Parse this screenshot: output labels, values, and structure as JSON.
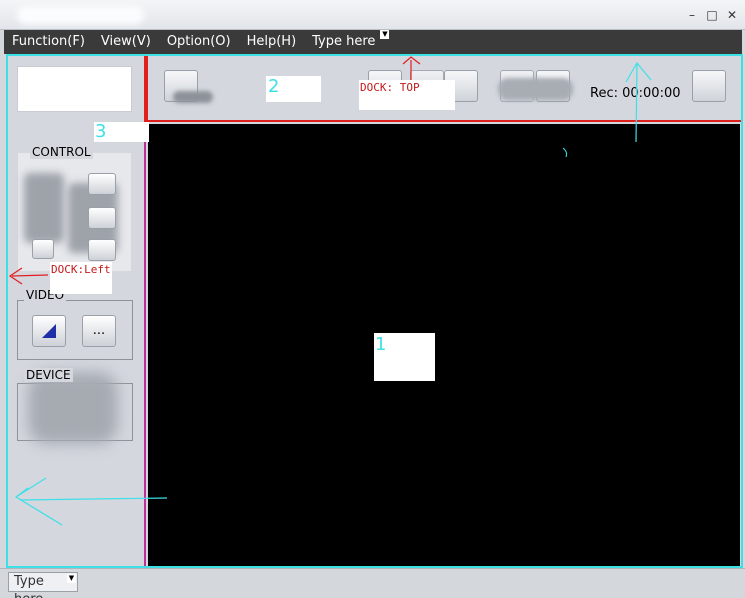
{
  "window": {
    "controls": {
      "minimize": "–",
      "maximize": "□",
      "close": "✕"
    }
  },
  "menu": {
    "items": [
      "Function(F)",
      "View(V)",
      "Option(O)",
      "Help(H)"
    ],
    "type_here": "Type here",
    "dropdown_glyph": "▼"
  },
  "top_panel": {
    "rec_label": "Rec: 00:00:00"
  },
  "left_panel": {
    "control_label": "CONTROL",
    "video_label": "VIDEO",
    "video_more": "...",
    "device_label": "DEVICE"
  },
  "annotations": {
    "num1": "1",
    "num2": "2",
    "num3": "3",
    "dock_top": "DOCK: TOP",
    "dock_left": "DOCK:Left"
  },
  "status": {
    "type_here": "Type here"
  },
  "colors": {
    "annotation_cyan": "#3ee0e8",
    "dock_red": "#e01f1f",
    "menubar_bg": "#3a3a3a"
  }
}
